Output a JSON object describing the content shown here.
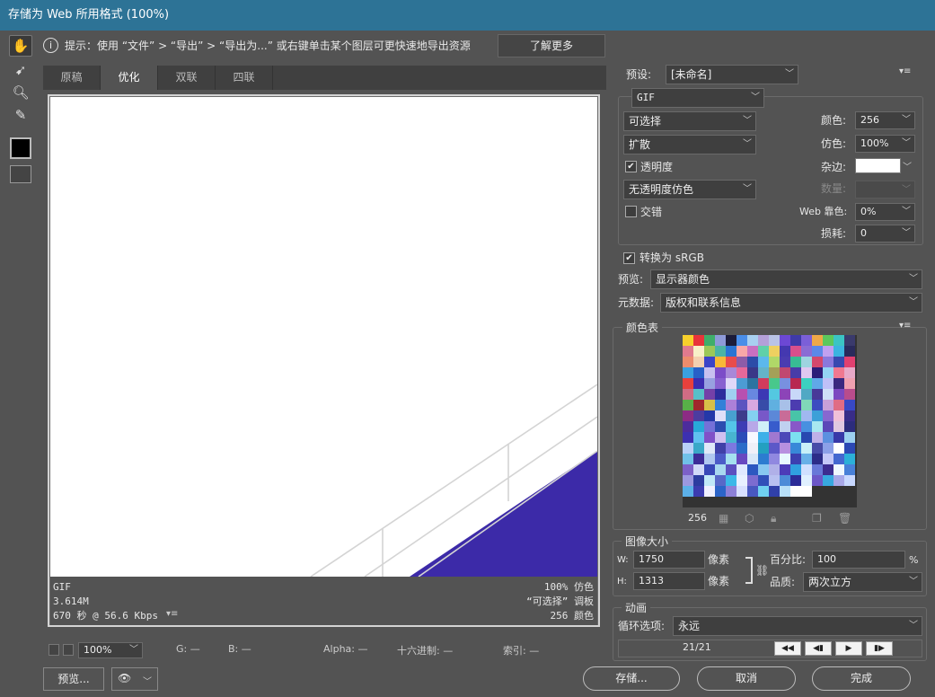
{
  "window": {
    "title": "存储为 Web 所用格式 (100%)"
  },
  "tip": {
    "text": "提示：使用 “文件” > “导出” > “导出为...” 或右键单击某个图层可更快速地导出资源",
    "learn_more": "了解更多"
  },
  "tabs": [
    {
      "label": "原稿"
    },
    {
      "label": "优化"
    },
    {
      "label": "双联"
    },
    {
      "label": "四联"
    }
  ],
  "tool_icons": [
    "hand-icon",
    "slice-select-icon",
    "zoom-icon",
    "eyedropper-icon",
    "color-swatch-icon",
    "toggle-slices-icon"
  ],
  "preview_info": {
    "format": "GIF",
    "size": "3.614M",
    "time": "670 秒 @ 56.6 Kbps",
    "dither": "100% 仿色",
    "palette": "“可选择” 调板",
    "colors": "256 颜色"
  },
  "status": {
    "zoom": "100%",
    "g": "G: —",
    "b": "B: —",
    "alpha": "Alpha: —",
    "hex": "十六进制: —",
    "index": "索引: —"
  },
  "settings": {
    "preset_label": "预设:",
    "preset_value": "[未命名]",
    "format": "GIF",
    "reduction": "可选择",
    "dither_algo": "扩散",
    "colors_label": "颜色:",
    "colors_value": "256",
    "dither_label": "仿色:",
    "dither_value": "100%",
    "transparency_label": "透明度",
    "transparency_checked": true,
    "matte_label": "杂边:",
    "transparency_dither": "无透明度仿色",
    "amount_label": "数量:",
    "interlaced_label": "交错",
    "interlaced_checked": false,
    "web_snap_label": "Web 靠色:",
    "web_snap_value": "0%",
    "lossy_label": "损耗:",
    "lossy_value": "0",
    "srgb_label": "转换为 sRGB",
    "srgb_checked": true,
    "preview_label": "预览:",
    "preview_value": "显示器颜色",
    "metadata_label": "元数据:",
    "metadata_value": "版权和联系信息"
  },
  "color_table": {
    "title": "颜色表",
    "count": "256",
    "colors": [
      "#f7d02c",
      "#e8343a",
      "#3fae6a",
      "#8e9ad8",
      "#1c1c3a",
      "#4a8ee8",
      "#a8d0f0",
      "#b4a0d8",
      "#b9c3e6",
      "#6c48d4",
      "#3f3aa8",
      "#7b5fd8",
      "#f0a848",
      "#5cc85c",
      "#3bc4c4",
      "#3a3a6c",
      "#e07a8e",
      "#f8f0c8",
      "#9cc858",
      "#4cb4a4",
      "#2a74d4",
      "#f8a8a8",
      "#c870c0",
      "#60d0a8",
      "#eed060",
      "#4438b0",
      "#d8508c",
      "#8a6cd4",
      "#5c88e8",
      "#c0a0f0",
      "#3bb4e0",
      "#2a2a5c",
      "#ec8c6c",
      "#f4d0b0",
      "#3c44c8",
      "#f8b838",
      "#e84c4c",
      "#8c5ca8",
      "#2c4ca8",
      "#5cb8ec",
      "#b0d868",
      "#4a3cb0",
      "#38bc94",
      "#9ed4e0",
      "#d4486c",
      "#8a78dc",
      "#3848b0",
      "#e04070",
      "#3aa0e0",
      "#2860c8",
      "#c8c0f0",
      "#7c4cc8",
      "#a888d8",
      "#e6689a",
      "#3a3888",
      "#64b4c8",
      "#a4a058",
      "#c04870",
      "#483ca8",
      "#e0c8f0",
      "#2c1c78",
      "#94d4f4",
      "#f07890",
      "#e8a8c8",
      "#e8403c",
      "#3c2cb0",
      "#98a0e0",
      "#8860d0",
      "#e0d8f8",
      "#4c9cd4",
      "#2c74a0",
      "#d03c5c",
      "#48c88c",
      "#7890e0",
      "#b82850",
      "#3cd0c0",
      "#60a8e8",
      "#c0c0f8",
      "#3a2880",
      "#f0a0b0",
      "#d06c84",
      "#58c0c8",
      "#7440a8",
      "#2c2c9c",
      "#a0d0f0",
      "#b850b0",
      "#6888e0",
      "#3c38b4",
      "#54c8e0",
      "#8c44b8",
      "#c8d8f8",
      "#50a8c4",
      "#483898",
      "#d0e0f8",
      "#7c48c0",
      "#b84c8c",
      "#58b048",
      "#a0282c",
      "#d8c048",
      "#3480d8",
      "#ac80d8",
      "#5c54c0",
      "#d8a8e0",
      "#384ca8",
      "#60b0e0",
      "#a8c0e8",
      "#4c3cb0",
      "#80d8b8",
      "#3c4cc0",
      "#c8a0d8",
      "#e06c84",
      "#3848c4",
      "#8c2c84",
      "#4c3ca0",
      "#2438a8",
      "#e0e0f8",
      "#48a0d0",
      "#3c3c8c",
      "#84d0f0",
      "#7858c8",
      "#5c88d8",
      "#c86c98",
      "#48c4a8",
      "#a0b8f0",
      "#3ca0d8",
      "#8868d0",
      "#f0c0d8",
      "#382c88",
      "#4c2c9c",
      "#28a8d8",
      "#7470d8",
      "#2c4cb0",
      "#54c4e8",
      "#3c3cb4",
      "#b8a8e8",
      "#d0f0f8",
      "#385ccc",
      "#c0d0f0",
      "#8858c8",
      "#4890e0",
      "#a8e8f0",
      "#5c48b8",
      "#e0c8e0",
      "#2c2c7c",
      "#3c30b0",
      "#60c0f0",
      "#8050c8",
      "#d0c0f0",
      "#48b4d0",
      "#2c4cb8",
      "#f8f8ff",
      "#3cb0e8",
      "#a078d0",
      "#4c48b8",
      "#7ce0f0",
      "#2848b0",
      "#c0b0e8",
      "#5c90e0",
      "#3838a8",
      "#9cd0f0",
      "#b8d0f8",
      "#3aa8c8",
      "#e0e8f8",
      "#4040a8",
      "#7c78e0",
      "#2c6cc8",
      "#f0f0f8",
      "#24a0c0",
      "#5c58c8",
      "#b890e0",
      "#3888d8",
      "#c8f0f8",
      "#484ca8",
      "#8ca0e8",
      "#ffffff",
      "#2c48b4",
      "#70c0e8",
      "#3c2c98",
      "#b0c8f0",
      "#4c5cc8",
      "#a4e0f0",
      "#6848c0",
      "#d8e8f8",
      "#2c7cd0",
      "#9088e0",
      "#e8f8ff",
      "#3c40b0",
      "#68b0e8",
      "#2c2c88",
      "#c4c8f8",
      "#4468d0",
      "#2cb0d8",
      "#7c60c8",
      "#d0d8f8",
      "#3848b8",
      "#a8d8f0",
      "#5c50c0",
      "#e0e8ff",
      "#2c58c0",
      "#88c8f0",
      "#b0b0e8",
      "#4c3cb8",
      "#30a0e0",
      "#d0e0ff",
      "#6878d8",
      "#3c2c90",
      "#f0f8ff",
      "#4880d8",
      "#9c98e0",
      "#2c3ca0",
      "#c0e8f8",
      "#5868c8",
      "#3cb8e8",
      "#e8f0ff",
      "#7c6cd0",
      "#3050b8",
      "#b8c0f0",
      "#4c8cd8",
      "#2c2c98",
      "#e0f0ff",
      "#6c58c8",
      "#38a8e0",
      "#a8a8e8",
      "#c8d8ff",
      "#5cb0e8",
      "#3c3cb0",
      "#f0f0ff",
      "#2c64c8",
      "#8c80d8",
      "#d8e0ff",
      "#4858c0",
      "#70d0f0",
      "#3040a8",
      "#b8e0f8",
      "#ffffff",
      "#ffffff"
    ]
  },
  "image_size": {
    "title": "图像大小",
    "w_label": "W:",
    "w_value": "1750",
    "h_label": "H:",
    "h_value": "1313",
    "unit": "像素",
    "percent_label": "百分比:",
    "percent_value": "100",
    "percent_unit": "%",
    "quality_label": "品质:",
    "quality_value": "两次立方"
  },
  "animation": {
    "title": "动画",
    "loop_label": "循环选项:",
    "loop_value": "永远",
    "frame": "21/21"
  },
  "footer": {
    "preview": "预览...",
    "save": "存储...",
    "cancel": "取消",
    "done": "完成"
  }
}
